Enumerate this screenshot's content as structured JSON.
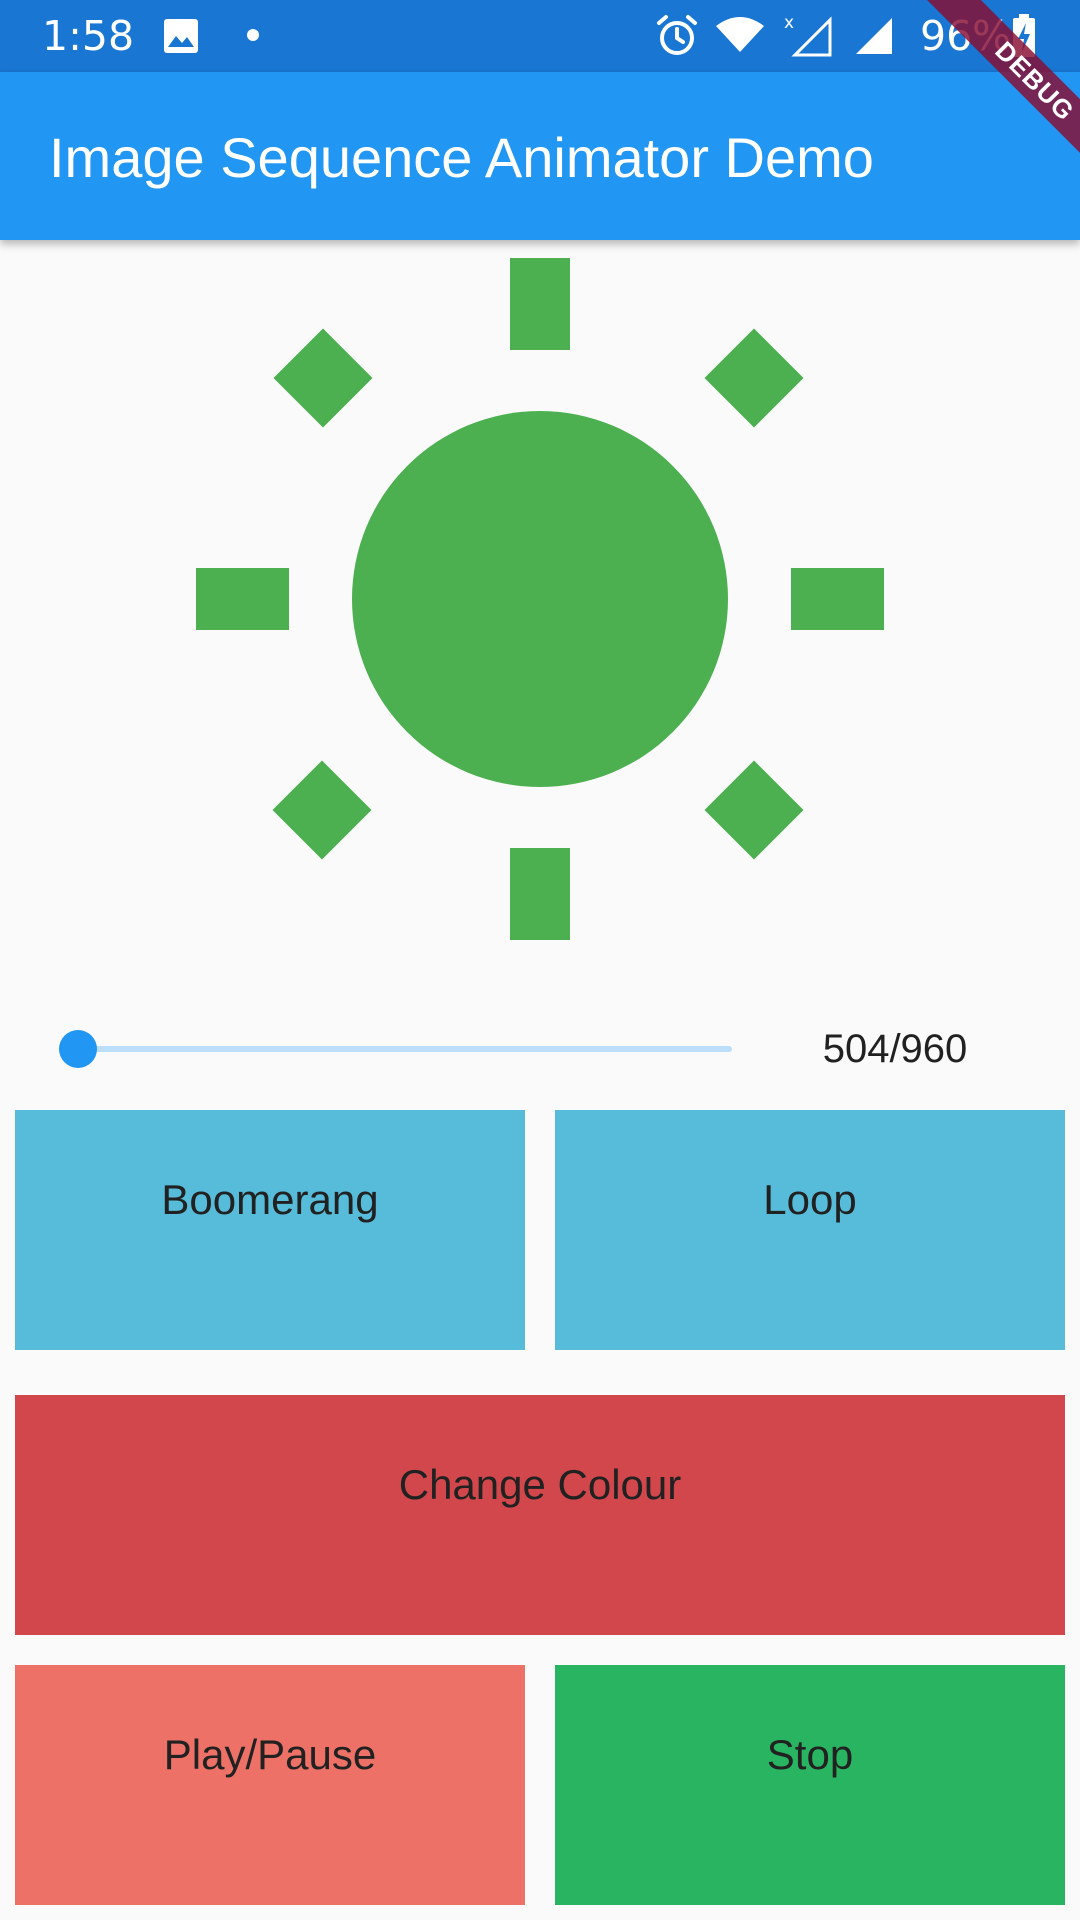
{
  "status_bar": {
    "time": "1:58",
    "battery_percent": "96%",
    "icons": [
      "image-icon",
      "dot-icon",
      "alarm-icon",
      "wifi-icon",
      "no-signal-icon",
      "signal-icon",
      "battery-charging-icon"
    ]
  },
  "app_bar": {
    "title": "Image Sequence Animator Demo"
  },
  "debug_banner": {
    "label": "DEBUG"
  },
  "image": {
    "icon": "sun-icon",
    "color": "#4caf50"
  },
  "slider": {
    "progress_fraction": 0.0,
    "counter_text": "504/960"
  },
  "buttons": {
    "boomerang": {
      "label": "Boomerang",
      "color": "#56bcd9"
    },
    "loop": {
      "label": "Loop",
      "color": "#56bcd9"
    },
    "change_colour": {
      "label": "Change Colour",
      "color": "#d2474b"
    },
    "play_pause": {
      "label": "Play/Pause",
      "color": "#ed7167"
    },
    "stop": {
      "label": "Stop",
      "color": "#29b461"
    }
  },
  "colors": {
    "status_bar": "#1976d2",
    "app_bar": "#2196f3",
    "slider_thumb": "#2196f3",
    "slider_track": "#bbdefb",
    "background": "#fafafa"
  }
}
